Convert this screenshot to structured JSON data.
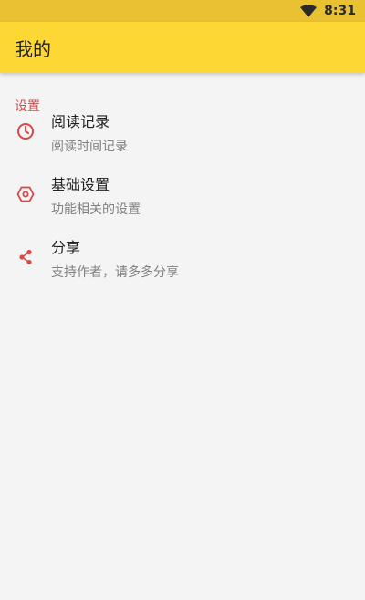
{
  "status_bar": {
    "time": "8:31"
  },
  "app_bar": {
    "title": "我的"
  },
  "settings_section": {
    "header": "设置",
    "items": [
      {
        "label": "阅读记录",
        "summary": "阅读时间记录",
        "icon": "clock-icon"
      },
      {
        "label": "基础设置",
        "summary": "功能相关的设置",
        "icon": "gear-icon"
      },
      {
        "label": "分享",
        "summary": "支持作者，请多多分享",
        "icon": "share-icon"
      }
    ]
  },
  "colors": {
    "status_bar": "#e8c233",
    "app_bar": "#fdd835",
    "accent": "#d84848",
    "background": "#f4f4f4"
  }
}
